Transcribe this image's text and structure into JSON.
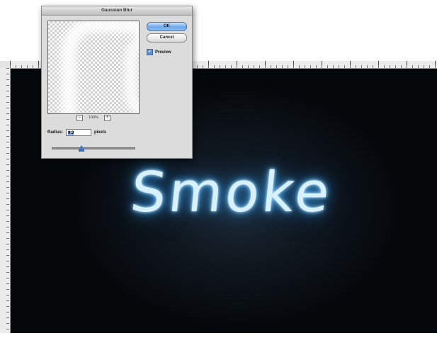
{
  "dialog": {
    "title": "Gaussian Blur",
    "ok_label": "OK",
    "cancel_label": "Cancel",
    "preview_label": "Preview",
    "preview_checked": true,
    "zoom_out_symbol": "−",
    "zoom_in_symbol": "+",
    "zoom_value": "100%",
    "radius_label": "Radius:",
    "radius_value": "9.3",
    "radius_unit": "pixels",
    "radius_slider_fraction": 0.36
  },
  "canvas": {
    "text": "Smoke",
    "glow_color": "#56b7ff",
    "background_color": "#05080b"
  },
  "icons": {
    "checkbox_mark": "✓"
  }
}
